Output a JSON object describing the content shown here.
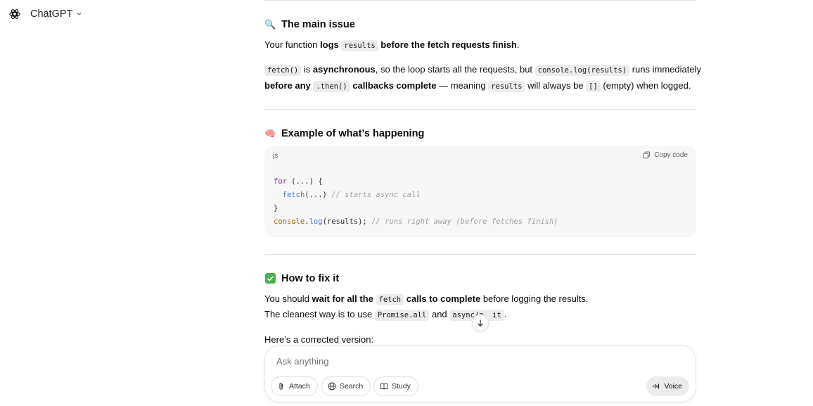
{
  "app": {
    "model_name": "ChatGPT",
    "logo_icon": "openai-logo-icon",
    "chevron_icon": "chevron-down-icon"
  },
  "sections": {
    "main_issue": {
      "emoji": "🔍",
      "title": "The main issue",
      "p1": {
        "t1": "Your function ",
        "b1": "logs",
        "c1": "results",
        "b2": "before the fetch requests finish",
        "t2": "."
      },
      "p2": {
        "c1": "fetch()",
        "t1": " is ",
        "b1": "asynchronous",
        "t2": ", so the loop starts all the requests, but ",
        "c2": "console.log(results)",
        "t3": " runs immediately",
        "b2": "before any",
        "c3": ".then()",
        "b3": " callbacks complete",
        "t4": " — meaning ",
        "c4": "results",
        "t5": " will always be ",
        "c5": "[]",
        "t6": " (empty) when logged."
      }
    },
    "example": {
      "emoji": "🧠",
      "title": "Example of what’s happening",
      "code": {
        "lang": "js",
        "copy_label": "Copy code",
        "l1_kw": "for",
        "l1_rest": " (...) {",
        "l2_fn": "fetch",
        "l2_rest": "(...) ",
        "l2_cm": "// starts async call",
        "l3": "}",
        "l4_obj": "console",
        "l4_dot": ".",
        "l4_fn": "log",
        "l4_rest": "(results); ",
        "l4_cm": "// runs right away (before fetches finish)"
      }
    },
    "fix": {
      "emoji": "✅",
      "title": "How to fix it",
      "p1": {
        "t1": "You should ",
        "b1": "wait for all the",
        "c1": "fetch",
        "b2": " calls to complete",
        "t2": " before logging the results."
      },
      "p2": {
        "t1": "The cleanest way is to use ",
        "c1": "Promise.all",
        "t2": " and ",
        "c2": "async/a  it",
        "t3": "."
      },
      "p3": "Here’s a corrected version:"
    }
  },
  "scroll_button": {
    "icon": "arrow-down-icon"
  },
  "composer": {
    "placeholder": "Ask anything",
    "attach_label": "Attach",
    "search_label": "Search",
    "study_label": "Study",
    "voice_label": "Voice"
  }
}
